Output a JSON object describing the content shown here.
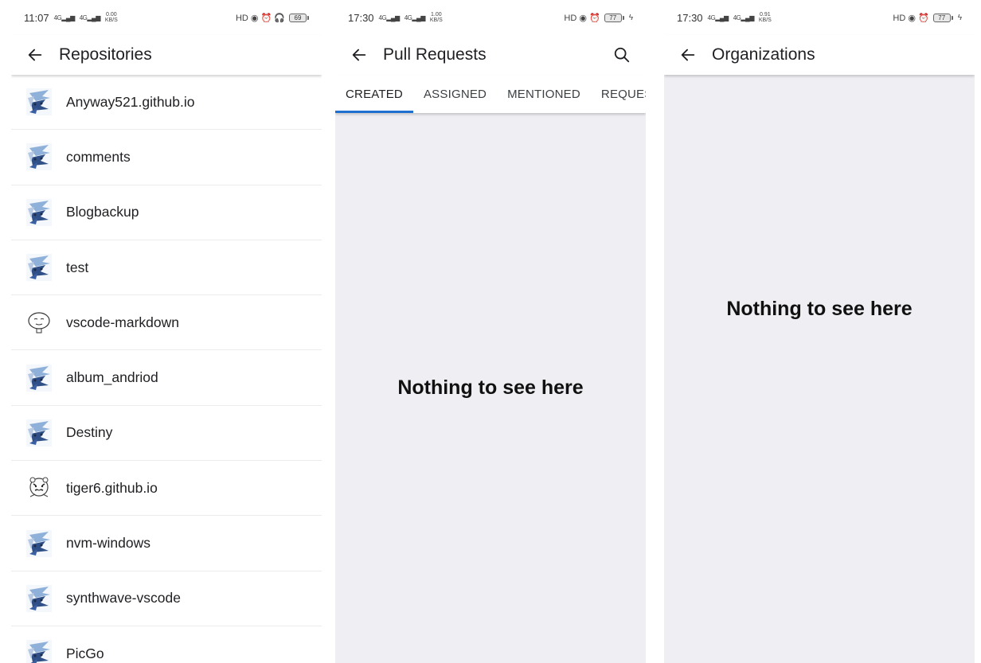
{
  "screens": [
    {
      "status": {
        "time": "11:07",
        "sig1": "4G",
        "sig2": "4G",
        "speed_top": "0.00",
        "speed_bottom": "KB/S",
        "indicators": "HD ◉ ⏰ 🎧",
        "battery": "69",
        "charging": false
      },
      "title": "Repositories",
      "repos": [
        {
          "name": "Anyway521.github.io",
          "avatar": "anime-avatar-icon"
        },
        {
          "name": "comments",
          "avatar": "anime-avatar-icon"
        },
        {
          "name": "Blogbackup",
          "avatar": "anime-avatar-icon"
        },
        {
          "name": "test",
          "avatar": "anime-avatar-icon"
        },
        {
          "name": "vscode-markdown",
          "avatar": "sketch-face-avatar-icon"
        },
        {
          "name": "album_andriod",
          "avatar": "anime-avatar-icon"
        },
        {
          "name": "Destiny",
          "avatar": "anime-avatar-icon"
        },
        {
          "name": "tiger6.github.io",
          "avatar": "tiger-avatar-icon"
        },
        {
          "name": "nvm-windows",
          "avatar": "anime-avatar-icon"
        },
        {
          "name": "synthwave-vscode",
          "avatar": "anime-avatar-icon"
        },
        {
          "name": "PicGo",
          "avatar": "anime-avatar-icon"
        }
      ]
    },
    {
      "status": {
        "time": "17:30",
        "sig1": "4G",
        "sig2": "4G",
        "speed_top": "1.00",
        "speed_bottom": "KB/S",
        "indicators": "HD ◉ ⏰",
        "battery": "77",
        "charging": true
      },
      "title": "Pull Requests",
      "tabs": [
        "CREATED",
        "ASSIGNED",
        "MENTIONED",
        "REQUESTED"
      ],
      "active_tab": "CREATED",
      "empty_text": "Nothing to see here"
    },
    {
      "status": {
        "time": "17:30",
        "sig1": "4G",
        "sig2": "4G",
        "speed_top": "0.91",
        "speed_bottom": "KB/S",
        "indicators": "HD ◉ ⏰",
        "battery": "77",
        "charging": true
      },
      "title": "Organizations",
      "empty_text": "Nothing to see here"
    }
  ],
  "colors": {
    "tab_indicator": "#1e6fd0",
    "empty_bg": "#efeff3"
  }
}
